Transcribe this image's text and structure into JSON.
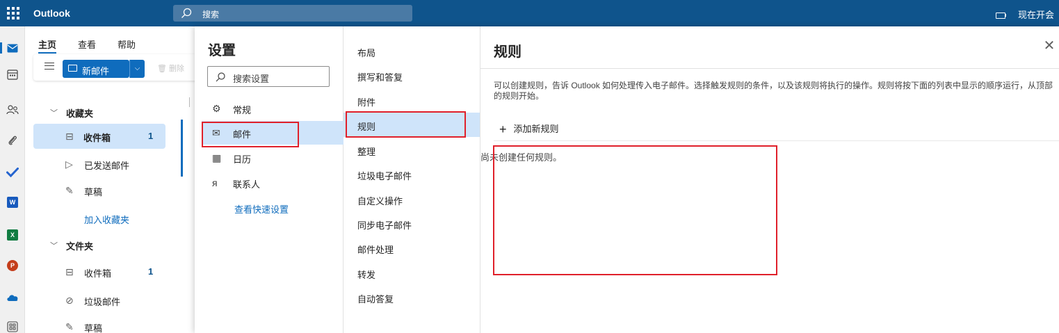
{
  "topbar": {
    "app_name": "Outlook",
    "search_placeholder": "搜索",
    "meet_now": "现在开会"
  },
  "rail": {
    "items": [
      "mail-icon",
      "calendar-icon",
      "people-icon",
      "attach-icon",
      "todo-icon",
      "word-icon",
      "excel-icon",
      "powerpoint-icon",
      "onedrive-icon",
      "apps-icon"
    ]
  },
  "ribbon": {
    "tabs": [
      "主页",
      "查看",
      "帮助"
    ],
    "new_mail": "新邮件",
    "delete": "删除"
  },
  "folders": {
    "favorites_header": "收藏夹",
    "favorites": [
      {
        "label": "收件箱",
        "count": "1"
      },
      {
        "label": "已发送邮件",
        "count": ""
      },
      {
        "label": "草稿",
        "count": ""
      }
    ],
    "add_favorite": "加入收藏夹",
    "folders_header": "文件夹",
    "folders": [
      {
        "label": "收件箱",
        "count": "1"
      },
      {
        "label": "垃圾邮件",
        "count": ""
      },
      {
        "label": "草稿",
        "count": ""
      }
    ]
  },
  "settings": {
    "title": "设置",
    "search_placeholder": "搜索设置",
    "categories": [
      {
        "label": "常规",
        "icon": "gear-icon"
      },
      {
        "label": "邮件",
        "icon": "mail-icon"
      },
      {
        "label": "日历",
        "icon": "calendar-icon"
      },
      {
        "label": "联系人",
        "icon": "people-icon"
      }
    ],
    "quick_settings_link": "查看快速设置",
    "mail_sections": [
      "布局",
      "撰写和答复",
      "附件",
      "规则",
      "整理",
      "垃圾电子邮件",
      "自定义操作",
      "同步电子邮件",
      "邮件处理",
      "转发",
      "自动答复"
    ],
    "selected_section": "规则"
  },
  "rules": {
    "title": "规则",
    "description": "可以创建规则，告诉 Outlook 如何处理传入电子邮件。选择触发规则的条件，以及该规则将执行的操作。规则将按下面的列表中显示的顺序运行，从顶部的规则开始。",
    "add_rule": "添加新规则",
    "empty_message": "尚未创建任何规则。"
  },
  "colors": {
    "topbar": "#0f548c",
    "accent": "#0f6cbd",
    "selected_bg": "#cfe4fa",
    "annotation": "#e0202a"
  }
}
